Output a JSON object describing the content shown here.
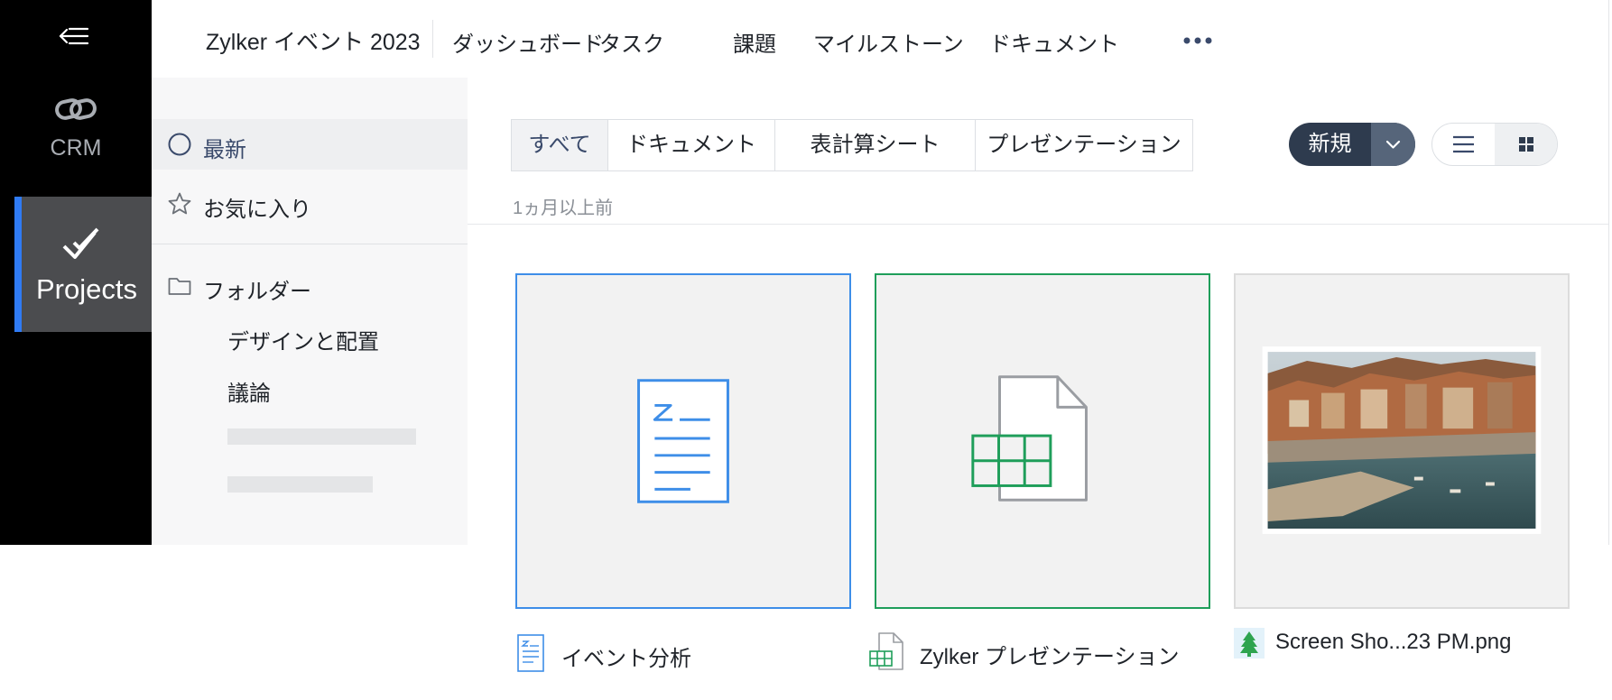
{
  "rail": {
    "crm_label": "CRM",
    "projects_label": "Projects",
    "accent_color": "#2f7bf5"
  },
  "topnav": {
    "project_title": "Zylker イベント 2023",
    "items": [
      "ダッシュボード",
      "タスク",
      "課題",
      "マイルストーン",
      "ドキュメント"
    ]
  },
  "sidebar": {
    "recent": "最新",
    "favorites": "お気に入り",
    "folders": "フォルダー",
    "subfolders": [
      "デザインと配置",
      "議論"
    ]
  },
  "main": {
    "filters": [
      "すべて",
      "ドキュメント",
      "表計算シート",
      "プレゼンテーション"
    ],
    "new_button": "新規",
    "section_label": "1ヵ月以上前",
    "files": [
      {
        "name": "イベント分析",
        "type": "document",
        "accent": "#3e8ee8"
      },
      {
        "name": "Zylker プレゼンテーション",
        "type": "spreadsheet",
        "accent": "#1f9e5a"
      },
      {
        "name": "Screen Sho...23 PM.png",
        "type": "image",
        "accent": "#2ea44f"
      }
    ]
  },
  "icons": {
    "menu": "collapse-menu-icon",
    "crm": "crm-logo-icon",
    "projects": "double-check-icon",
    "more": "more-horizontal-icon",
    "recent": "circle-icon",
    "favorites": "star-icon",
    "folders": "folder-icon",
    "dropdown": "chevron-down-icon",
    "list_view": "list-view-icon",
    "grid_view": "grid-view-icon"
  }
}
